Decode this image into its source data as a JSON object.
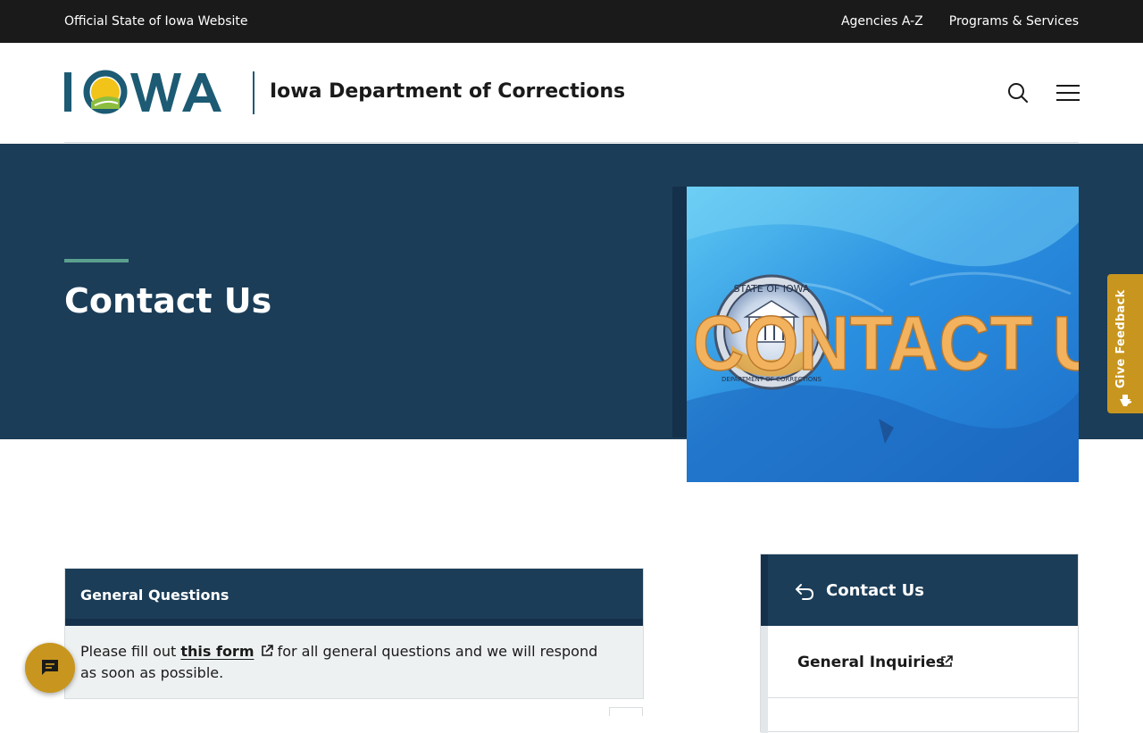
{
  "topbar": {
    "official": "Official State of Iowa Website",
    "links": [
      "Agencies A-Z",
      "Programs & Services"
    ]
  },
  "header": {
    "logo_text": "IOWA",
    "dept_name": "Iowa Department of Corrections",
    "search_icon": "search-icon",
    "menu_icon": "hamburger-menu-icon"
  },
  "hero": {
    "title": "Contact Us",
    "image": {
      "seal_text_top": "STATE OF IOWA",
      "seal_text_bottom": "DEPARTMENT OF CORRECTIONS",
      "banner_text": "CONTACT US"
    }
  },
  "feedback": {
    "label": "Give Feedback",
    "icon": "megaphone-icon"
  },
  "card": {
    "title": "General Questions",
    "body_before": "Please fill out ",
    "link_text": "this form",
    "body_after": " for all general questions and we will respond as soon as possible."
  },
  "sidebar": {
    "title": "Contact Us",
    "back_icon": "back-arrow-icon",
    "items": [
      {
        "label": "General Inquiries",
        "icon": "external-link-icon"
      }
    ]
  },
  "chat": {
    "icon": "chat-icon"
  },
  "colors": {
    "dark_bar": "#1a1a1a",
    "navy": "#1b3d58",
    "teal_accent": "#5ba08f",
    "gold": "#c8961e",
    "iowa_blue": "#1c5b73"
  }
}
